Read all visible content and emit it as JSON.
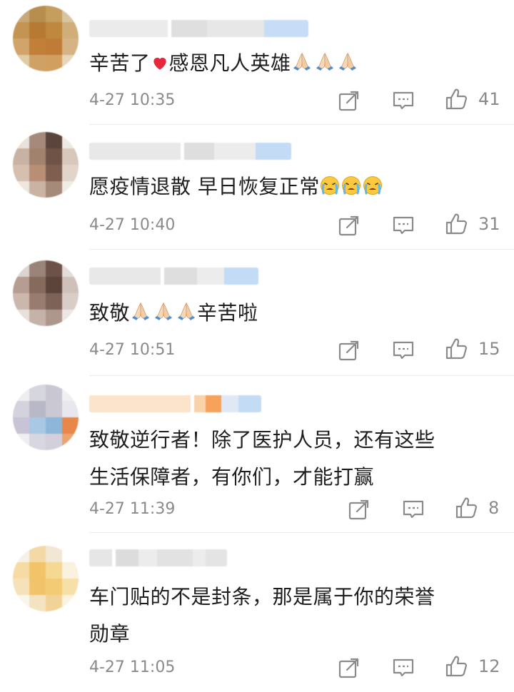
{
  "colors": {
    "text": "#1e1e1e",
    "meta": "#8a8a8a",
    "icon": "#8a8a8a",
    "heart": "#e8273a"
  },
  "comments": [
    {
      "text_before": "辛苦了",
      "text_middle": "感恩凡人英雄",
      "text_after": "",
      "time": "4-27 10:35",
      "likes": "41"
    },
    {
      "text_before": "愿疫情退散 早日恢复正常",
      "text_middle": "",
      "text_after": "",
      "time": "4-27 10:40",
      "likes": "31"
    },
    {
      "text_before": "致敬",
      "text_middle": "",
      "text_after": "辛苦啦",
      "time": "4-27 10:51",
      "likes": "15"
    },
    {
      "line1": "致敬逆行者！除了医护人员，还有这些",
      "line2": "生活保障者，有你们，才能打赢",
      "time": "4-27 11:39",
      "likes": "8"
    },
    {
      "line1": "车门贴的不是封条，那是属于你的荣誉",
      "line2": "勋章",
      "time": "4-27 11:05",
      "likes": "12"
    }
  ],
  "icons": {
    "share": "share-icon",
    "reply": "comment-icon",
    "like": "thumbs-up-icon"
  }
}
